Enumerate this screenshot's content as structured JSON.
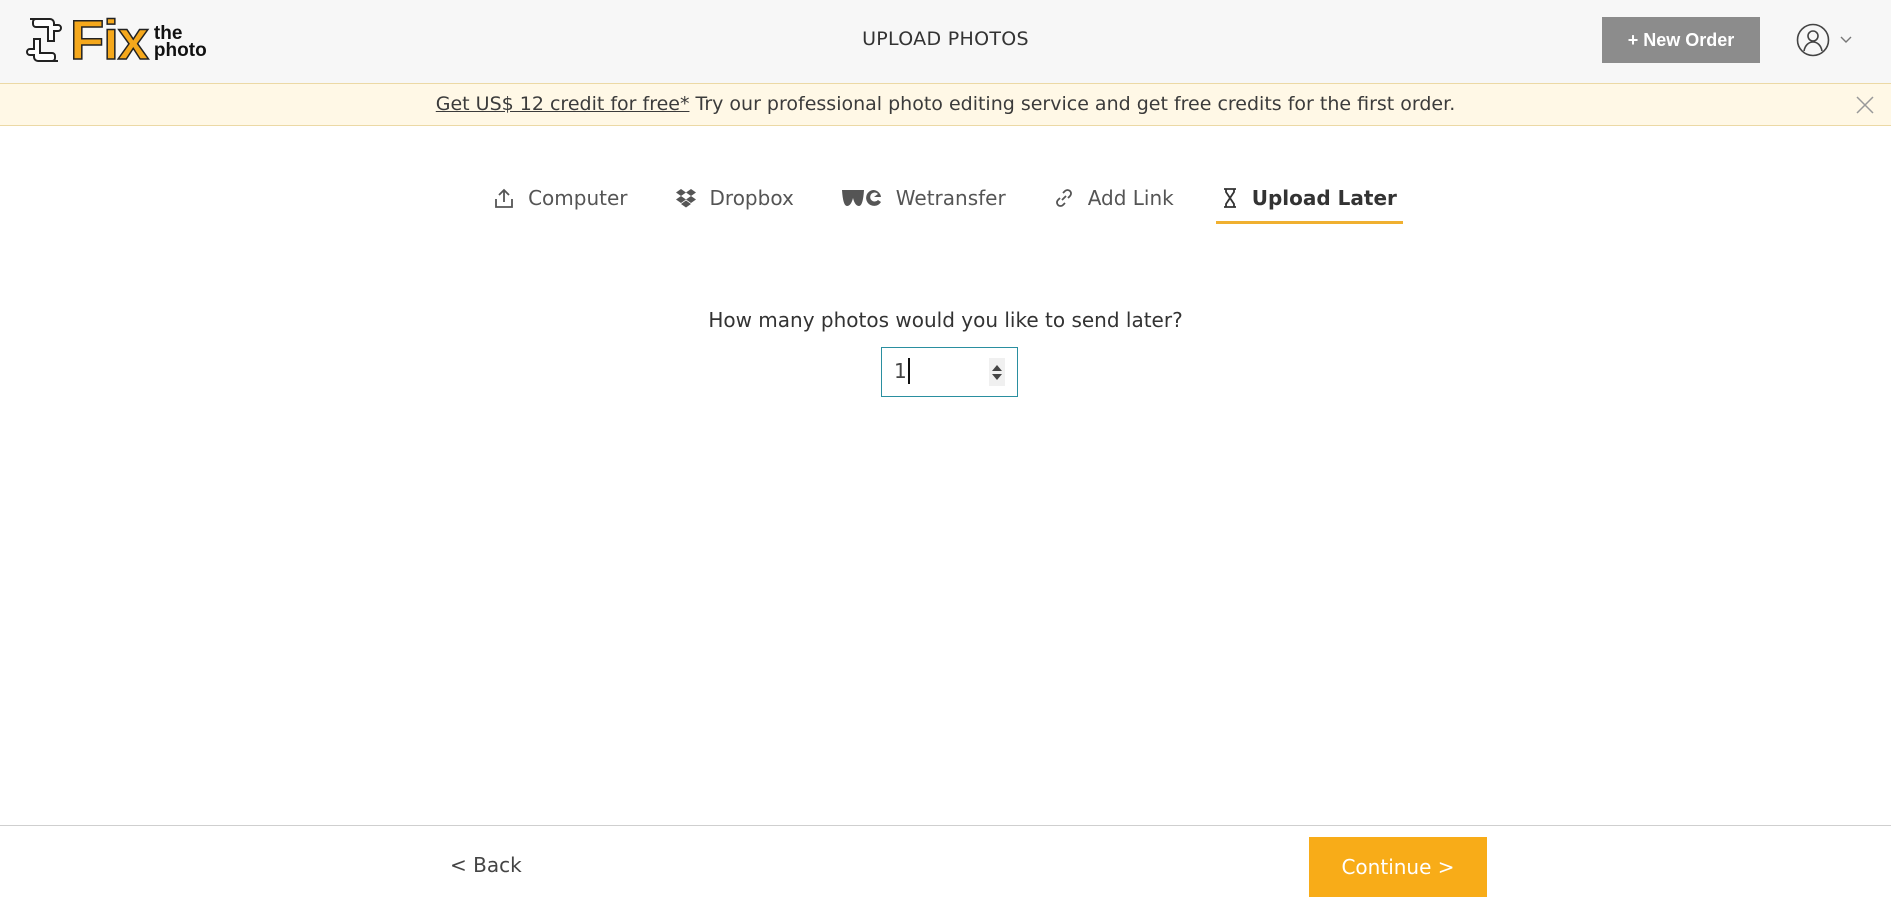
{
  "header": {
    "logo_main": "Fix",
    "logo_sub_top": "the",
    "logo_sub_bottom": "photo",
    "title": "UPLOAD PHOTOS",
    "new_order_label": "+ New Order"
  },
  "banner": {
    "link_text": "Get US$ 12 credit for free*",
    "text": " Try our professional photo editing service and get free credits for the first order."
  },
  "tabs": [
    {
      "label": "Computer",
      "icon": "upload-icon",
      "active": false
    },
    {
      "label": "Dropbox",
      "icon": "dropbox-icon",
      "active": false
    },
    {
      "label": "Wetransfer",
      "icon": "wetransfer-icon",
      "active": false
    },
    {
      "label": "Add Link",
      "icon": "link-icon",
      "active": false
    },
    {
      "label": "Upload Later",
      "icon": "hourglass-icon",
      "active": true
    }
  ],
  "main": {
    "question": "How many photos would you like to send later?",
    "quantity_value": "1"
  },
  "footer": {
    "back_label": "< Back",
    "continue_label": "Continue >"
  },
  "colors": {
    "accent": "#f8ac18",
    "banner_bg": "#fff8e6",
    "new_order_bg": "#8c8c8c",
    "input_border": "#2a8fa0"
  }
}
